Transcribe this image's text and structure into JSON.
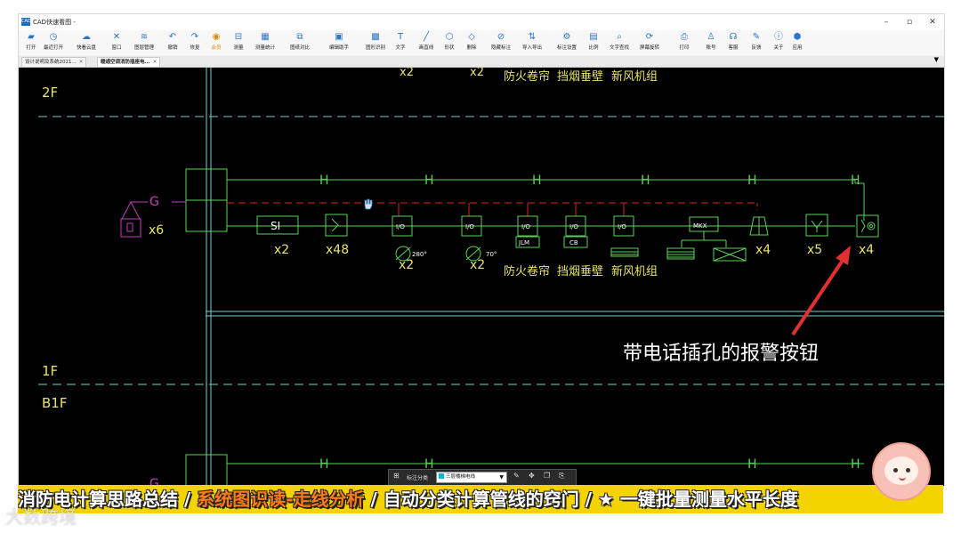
{
  "window": {
    "title": "CAD快速看图 -",
    "minimize": "–",
    "maximize": "▫",
    "close": "✕"
  },
  "toolbar": [
    {
      "label": "打开",
      "icon": "folder-icon"
    },
    {
      "label": "最近打开",
      "icon": "clock-icon"
    },
    {
      "label": "快看云盘",
      "icon": "cloud-icon"
    },
    {
      "label": "窗口",
      "icon": "window-icon"
    },
    {
      "label": "图层管理",
      "icon": "layers-icon"
    },
    {
      "label": "撤销",
      "icon": "undo-icon"
    },
    {
      "label": "恢复",
      "icon": "redo-icon"
    },
    {
      "label": "会员",
      "icon": "vip-icon"
    },
    {
      "label": "测量",
      "icon": "measure-icon"
    },
    {
      "label": "测量统计",
      "icon": "measure-stats-icon"
    },
    {
      "label": "图纸对比",
      "icon": "compare-icon"
    },
    {
      "label": "编辑助手",
      "icon": "edit-assistant-icon"
    },
    {
      "label": "图形识别",
      "icon": "shape-recognize-icon"
    },
    {
      "label": "文字",
      "icon": "text-icon"
    },
    {
      "label": "画直线",
      "icon": "line-icon"
    },
    {
      "label": "形状",
      "icon": "shape-icon"
    },
    {
      "label": "删除",
      "icon": "eraser-icon"
    },
    {
      "label": "隐藏标注",
      "icon": "hide-annotation-icon"
    },
    {
      "label": "导入导出",
      "icon": "import-export-icon"
    },
    {
      "label": "标注设置",
      "icon": "annotation-settings-icon"
    },
    {
      "label": "比例",
      "icon": "scale-icon"
    },
    {
      "label": "文字查找",
      "icon": "text-search-icon"
    },
    {
      "label": "屏幕旋转",
      "icon": "rotate-icon"
    },
    {
      "label": "打印",
      "icon": "print-icon"
    },
    {
      "label": "账号",
      "icon": "account-icon"
    },
    {
      "label": "客服",
      "icon": "support-icon"
    },
    {
      "label": "反馈",
      "icon": "feedback-icon"
    },
    {
      "label": "关于",
      "icon": "info-icon"
    },
    {
      "label": "应用",
      "icon": "apps-icon"
    }
  ],
  "tabs": [
    {
      "label": "设计说明及系统2021...",
      "active": false
    },
    {
      "label": "暖通空调消防插座电...",
      "active": true
    }
  ],
  "cad": {
    "floors": [
      "2F",
      "1F",
      "B1F"
    ],
    "top_partial": [
      "x2",
      "x2",
      "防火卷帘",
      "挡烟垂壁",
      "新风机组"
    ],
    "g_label": "G",
    "h_label": "H",
    "speaker_count": "x6",
    "device_boxes": [
      "SI",
      "I/O",
      "I/O",
      "I/O",
      "I/O",
      "I/O",
      "MKX"
    ],
    "device_subs": [
      "JLM",
      "CB"
    ],
    "counts": [
      "x2",
      "x48",
      "x2",
      "x2",
      "x4",
      "x5",
      "x4"
    ],
    "angles": [
      "280°",
      "70°"
    ],
    "equip_labels": [
      "防火卷帘",
      "挡烟垂壁",
      "新风机组"
    ]
  },
  "floatbar": {
    "label": "标注分类",
    "selected": "三层楼梯电线",
    "swatch_color": "#00b8d8"
  },
  "annotation": "带电话插孔的报警按钮",
  "caption": {
    "part1": "消防电计算思路总结 / ",
    "part2": "系统图识读-走线分析",
    "part3": " / 自动分类计算管线的窍门 / ★ 一键批量测量水平长度"
  },
  "watermark": "大数跨境",
  "colors": {
    "cad_background": "#000000",
    "cad_green": "#5ad25a",
    "cad_yellow": "#e8e36a",
    "cad_red": "#d22",
    "cad_magenta": "#c040c0",
    "cad_cyan": "#7ad0d0",
    "caption_bg": "#f3d400",
    "caption_highlight": "#ff7a1a"
  }
}
